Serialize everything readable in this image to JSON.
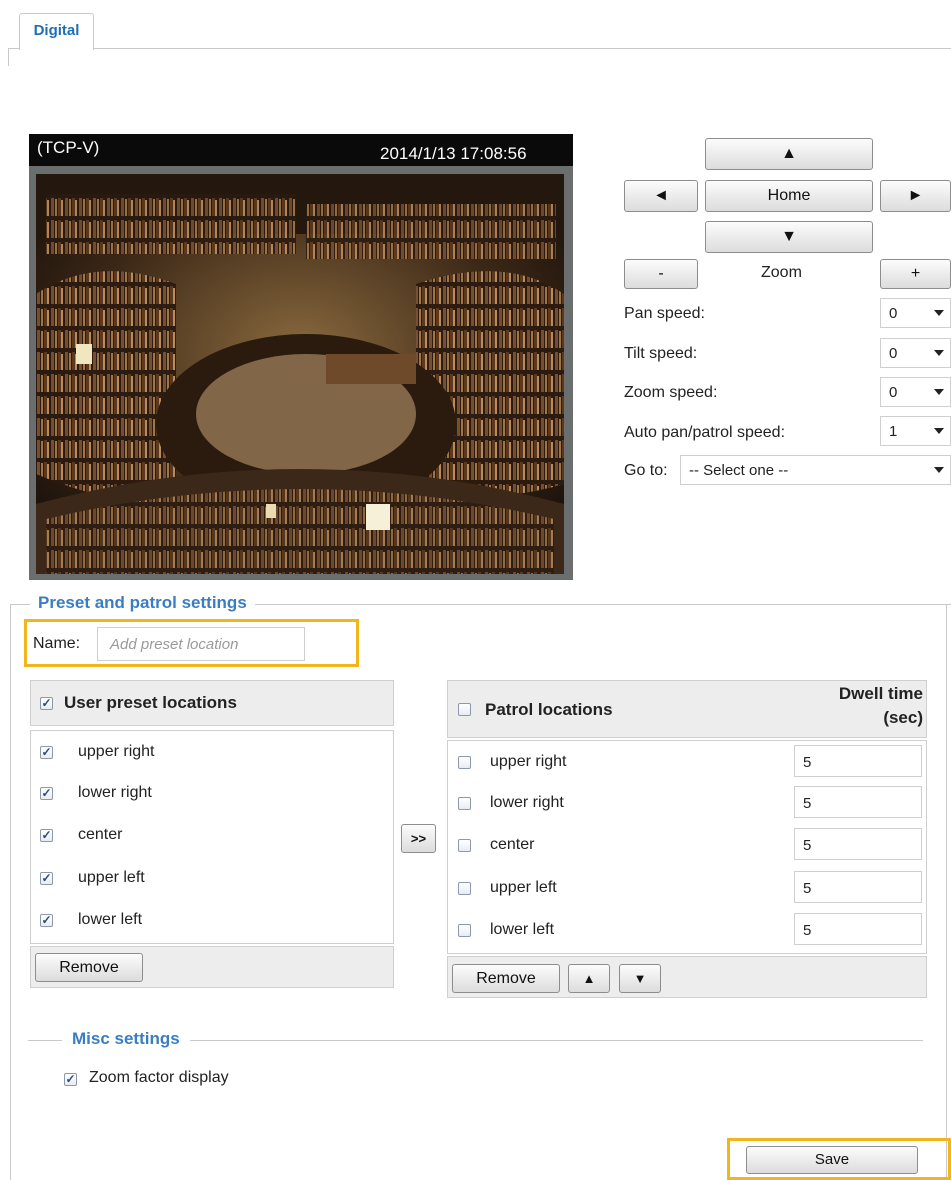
{
  "tab": {
    "label": "Digital"
  },
  "video": {
    "protocol": "(TCP-V)",
    "timestamp": "2014/1/13  17:08:56"
  },
  "ptz": {
    "up": "▲",
    "left": "◄",
    "home": "Home",
    "right": "►",
    "down": "▼",
    "zoom_out": "-",
    "zoom_label": "Zoom",
    "zoom_in": "+",
    "pan_speed_label": "Pan speed:",
    "pan_speed": "0",
    "tilt_speed_label": "Tilt speed:",
    "tilt_speed": "0",
    "zoom_speed_label": "Zoom speed:",
    "zoom_speed": "0",
    "auto_speed_label": "Auto pan/patrol speed:",
    "auto_speed": "1",
    "goto_label": "Go to:",
    "goto_value": "-- Select one --"
  },
  "preset": {
    "legend": "Preset and patrol settings",
    "name_label": "Name:",
    "name_placeholder": "Add preset location",
    "user_header": "User preset locations",
    "user_items": [
      "upper right",
      "lower right",
      "center",
      "upper left",
      "lower left"
    ],
    "remove_label": "Remove",
    "move_label": ">>",
    "patrol_header": "Patrol locations",
    "dwell_header_1": "Dwell time",
    "dwell_header_2": "(sec)",
    "patrol_items": [
      "upper right",
      "lower right",
      "center",
      "upper left",
      "lower left"
    ],
    "dwell_values": [
      "5",
      "5",
      "5",
      "5",
      "5"
    ],
    "patrol_remove_label": "Remove",
    "move_up": "▲",
    "move_down": "▼"
  },
  "misc": {
    "legend": "Misc settings",
    "zoom_display_label": "Zoom factor display"
  },
  "save_label": "Save",
  "colors": {
    "accent": "#3a7dc2",
    "highlight": "#f2b51c"
  }
}
